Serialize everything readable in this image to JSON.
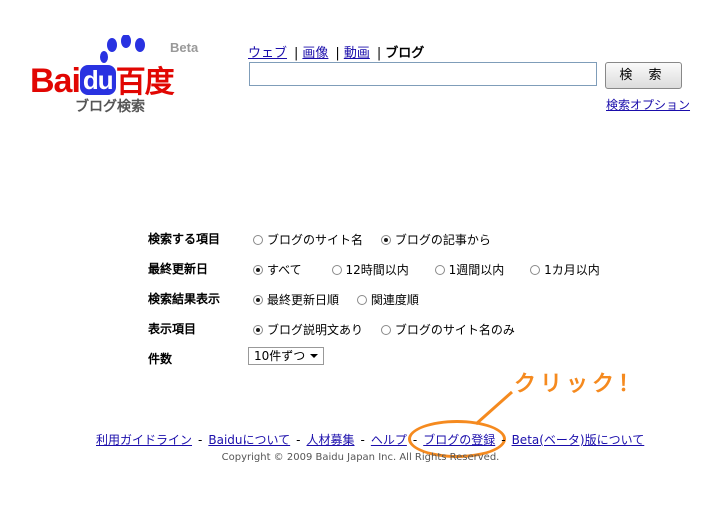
{
  "logo": {
    "bai": "Bai",
    "du": "du",
    "cn": "百度",
    "beta": "Beta",
    "subtitle": "ブログ検索"
  },
  "nav": {
    "items": [
      {
        "label": "ウェブ",
        "link": true
      },
      {
        "label": "画像",
        "link": true
      },
      {
        "label": "動画",
        "link": true
      },
      {
        "label": "ブログ",
        "link": false
      }
    ],
    "separator": "|"
  },
  "search": {
    "value": "",
    "button_label": "検 索",
    "options_link": "検索オプション"
  },
  "options": {
    "target": {
      "label": "検索する項目",
      "choices": [
        {
          "label": "ブログのサイト名",
          "selected": false
        },
        {
          "label": "ブログの記事から",
          "selected": true
        }
      ]
    },
    "updated": {
      "label": "最終更新日",
      "choices": [
        {
          "label": "すべて",
          "selected": true
        },
        {
          "label": "12時間以内",
          "selected": false
        },
        {
          "label": "1週間以内",
          "selected": false
        },
        {
          "label": "1カ月以内",
          "selected": false
        }
      ]
    },
    "sort": {
      "label": "検索結果表示",
      "choices": [
        {
          "label": "最終更新日順",
          "selected": true
        },
        {
          "label": "関連度順",
          "selected": false
        }
      ]
    },
    "display": {
      "label": "表示項目",
      "choices": [
        {
          "label": "ブログ説明文あり",
          "selected": true
        },
        {
          "label": "ブログのサイト名のみ",
          "selected": false
        }
      ]
    },
    "count": {
      "label": "件数",
      "selected": "10件ずつ"
    }
  },
  "annotation": {
    "text": "クリック！",
    "color": "#f58a1f"
  },
  "footer": {
    "links": [
      "利用ガイドライン",
      "Baiduについて",
      "人材募集",
      "ヘルプ",
      "ブログの登録",
      "Beta(ベータ)版について"
    ],
    "separator": "-",
    "copyright": "Copyright © 2009 Baidu Japan Inc. All Rights Reserved."
  }
}
